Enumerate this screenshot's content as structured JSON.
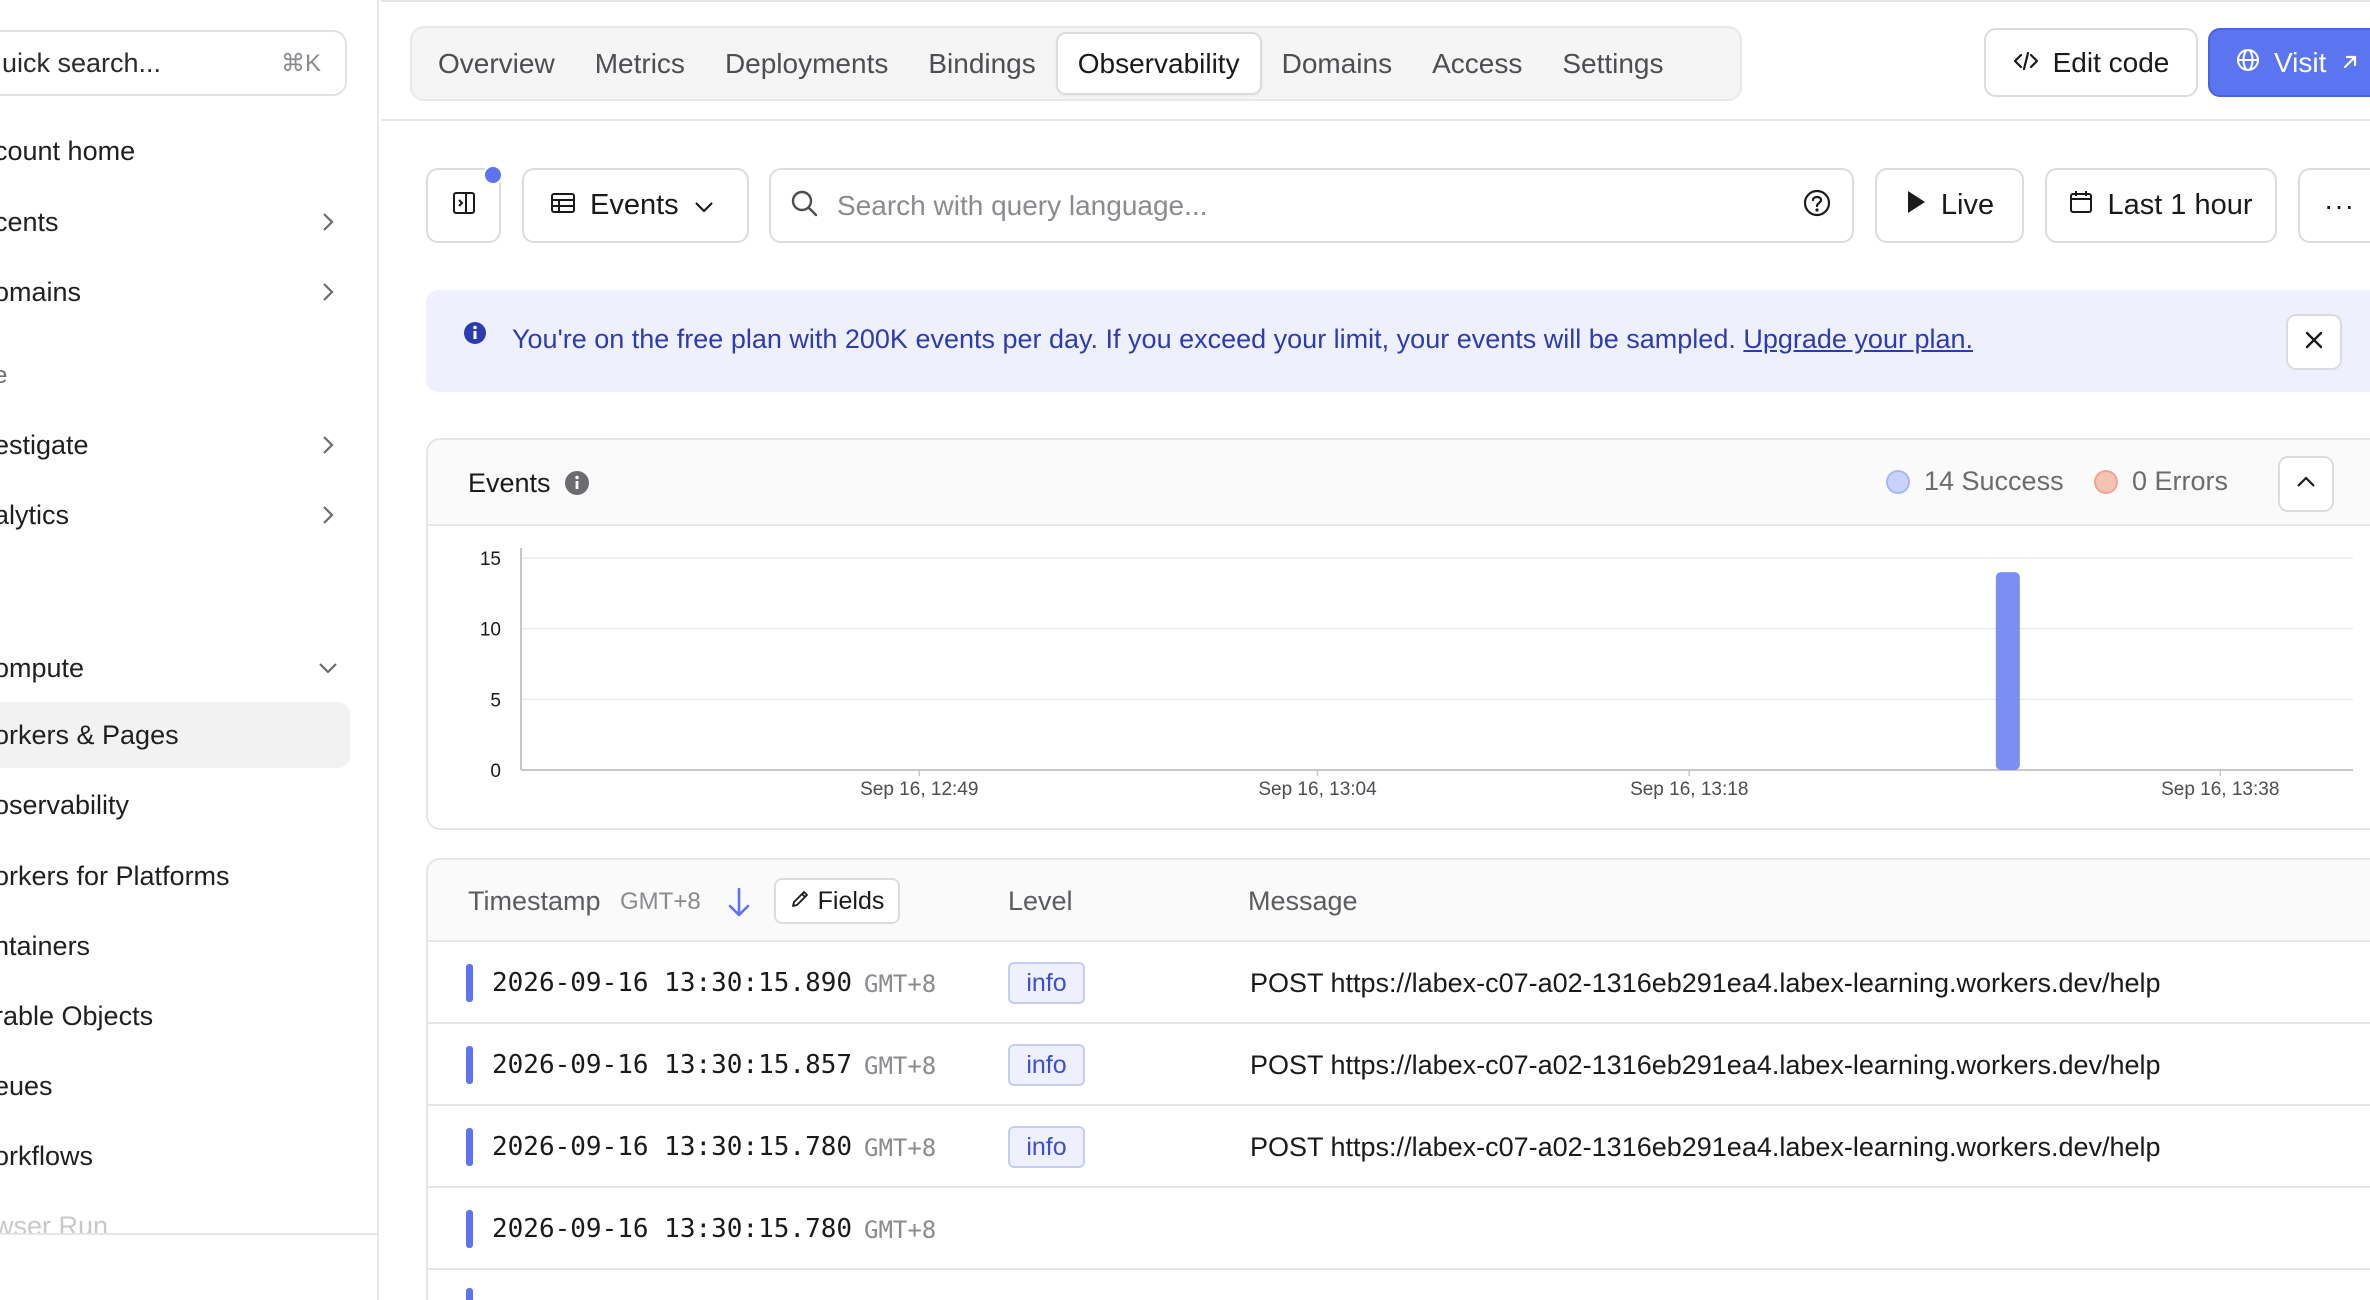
{
  "sidebar": {
    "search_placeholder": "uick search...",
    "search_shortcut": "⌘K",
    "items": [
      {
        "label": "count home"
      },
      {
        "label": "cents"
      },
      {
        "label": "omains"
      },
      {
        "label": "estigate"
      },
      {
        "label": "alytics"
      },
      {
        "label": "ompute"
      },
      {
        "label": "orkers & Pages"
      },
      {
        "label": "oservability"
      },
      {
        "label": "orkers for Platforms"
      },
      {
        "label": "ntainers"
      },
      {
        "label": "rable Objects"
      },
      {
        "label": "eues"
      },
      {
        "label": "orkflows"
      },
      {
        "label": "wser Run"
      }
    ],
    "section_label": "e"
  },
  "tabs": [
    "Overview",
    "Metrics",
    "Deployments",
    "Bindings",
    "Observability",
    "Domains",
    "Access",
    "Settings"
  ],
  "active_tab": "Observability",
  "header": {
    "edit_code": "Edit code",
    "visit": "Visit"
  },
  "toolbar": {
    "view": "Events",
    "search_placeholder": "Search with query language...",
    "live": "Live",
    "time_range": "Last 1 hour",
    "more": "···"
  },
  "banner": {
    "text": "You're on the free plan with 200K events per day. If you exceed your limit, your events will be sampled.",
    "link": "Upgrade your plan."
  },
  "events_card": {
    "title": "Events",
    "success_label": "14 Success",
    "errors_label": "0 Errors"
  },
  "chart_data": {
    "type": "bar",
    "yticks": [
      0,
      5,
      10,
      15
    ],
    "ylim": [
      0,
      15
    ],
    "xtick_labels": [
      "Sep 16, 12:49",
      "Sep 16, 13:04",
      "Sep 16, 13:18",
      "Sep 16, 13:38"
    ],
    "series": [
      {
        "name": "Success",
        "color": "#7b8ff2",
        "points": [
          {
            "x": "Sep 16, 13:30",
            "y": 14
          }
        ]
      },
      {
        "name": "Errors",
        "color": "#f0a58f",
        "points": []
      }
    ]
  },
  "table": {
    "col_timestamp": "Timestamp",
    "col_timezone": "GMT+8",
    "fields_btn": "Fields",
    "col_level": "Level",
    "col_message": "Message",
    "rows": [
      {
        "ts": "2026-09-16 13:30:15.890",
        "tz": "GMT+8",
        "level": "info",
        "message": "POST https://labex-c07-a02-1316eb291ea4.labex-learning.workers.dev/help"
      },
      {
        "ts": "2026-09-16 13:30:15.857",
        "tz": "GMT+8",
        "level": "info",
        "message": "POST https://labex-c07-a02-1316eb291ea4.labex-learning.workers.dev/help"
      },
      {
        "ts": "2026-09-16 13:30:15.780",
        "tz": "GMT+8",
        "level": "info",
        "message": "POST https://labex-c07-a02-1316eb291ea4.labex-learning.workers.dev/help"
      },
      {
        "ts": "2026-09-16 13:30:15.780",
        "tz": "GMT+8",
        "level": "",
        "message": ""
      }
    ]
  },
  "colors": {
    "accent": "#5b74f0",
    "success_dot": "#c9d2fb",
    "error_dot": "#f0a58f",
    "banner_bg": "#eef1fd",
    "banner_text": "#2d3bb0"
  }
}
